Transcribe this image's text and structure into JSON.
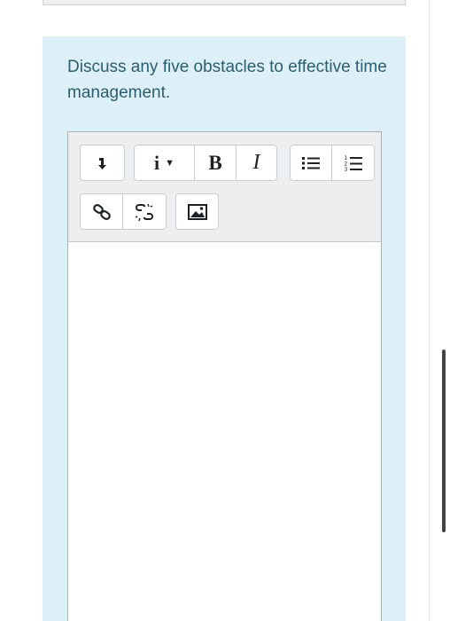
{
  "question": {
    "text": "Discuss any five obstacles to effective time management."
  },
  "toolbar": {
    "collapse_icon": "arrow-down-icon",
    "paragraph_label": "i",
    "paragraph_caret": "▼",
    "bold_label": "B",
    "italic_label": "I",
    "unordered_list_icon": "unordered-list-icon",
    "ordered_list_icon": "ordered-list-icon",
    "link_icon": "link-icon",
    "unlink_icon": "unlink-icon",
    "image_icon": "image-icon"
  },
  "editor": {
    "content": ""
  }
}
